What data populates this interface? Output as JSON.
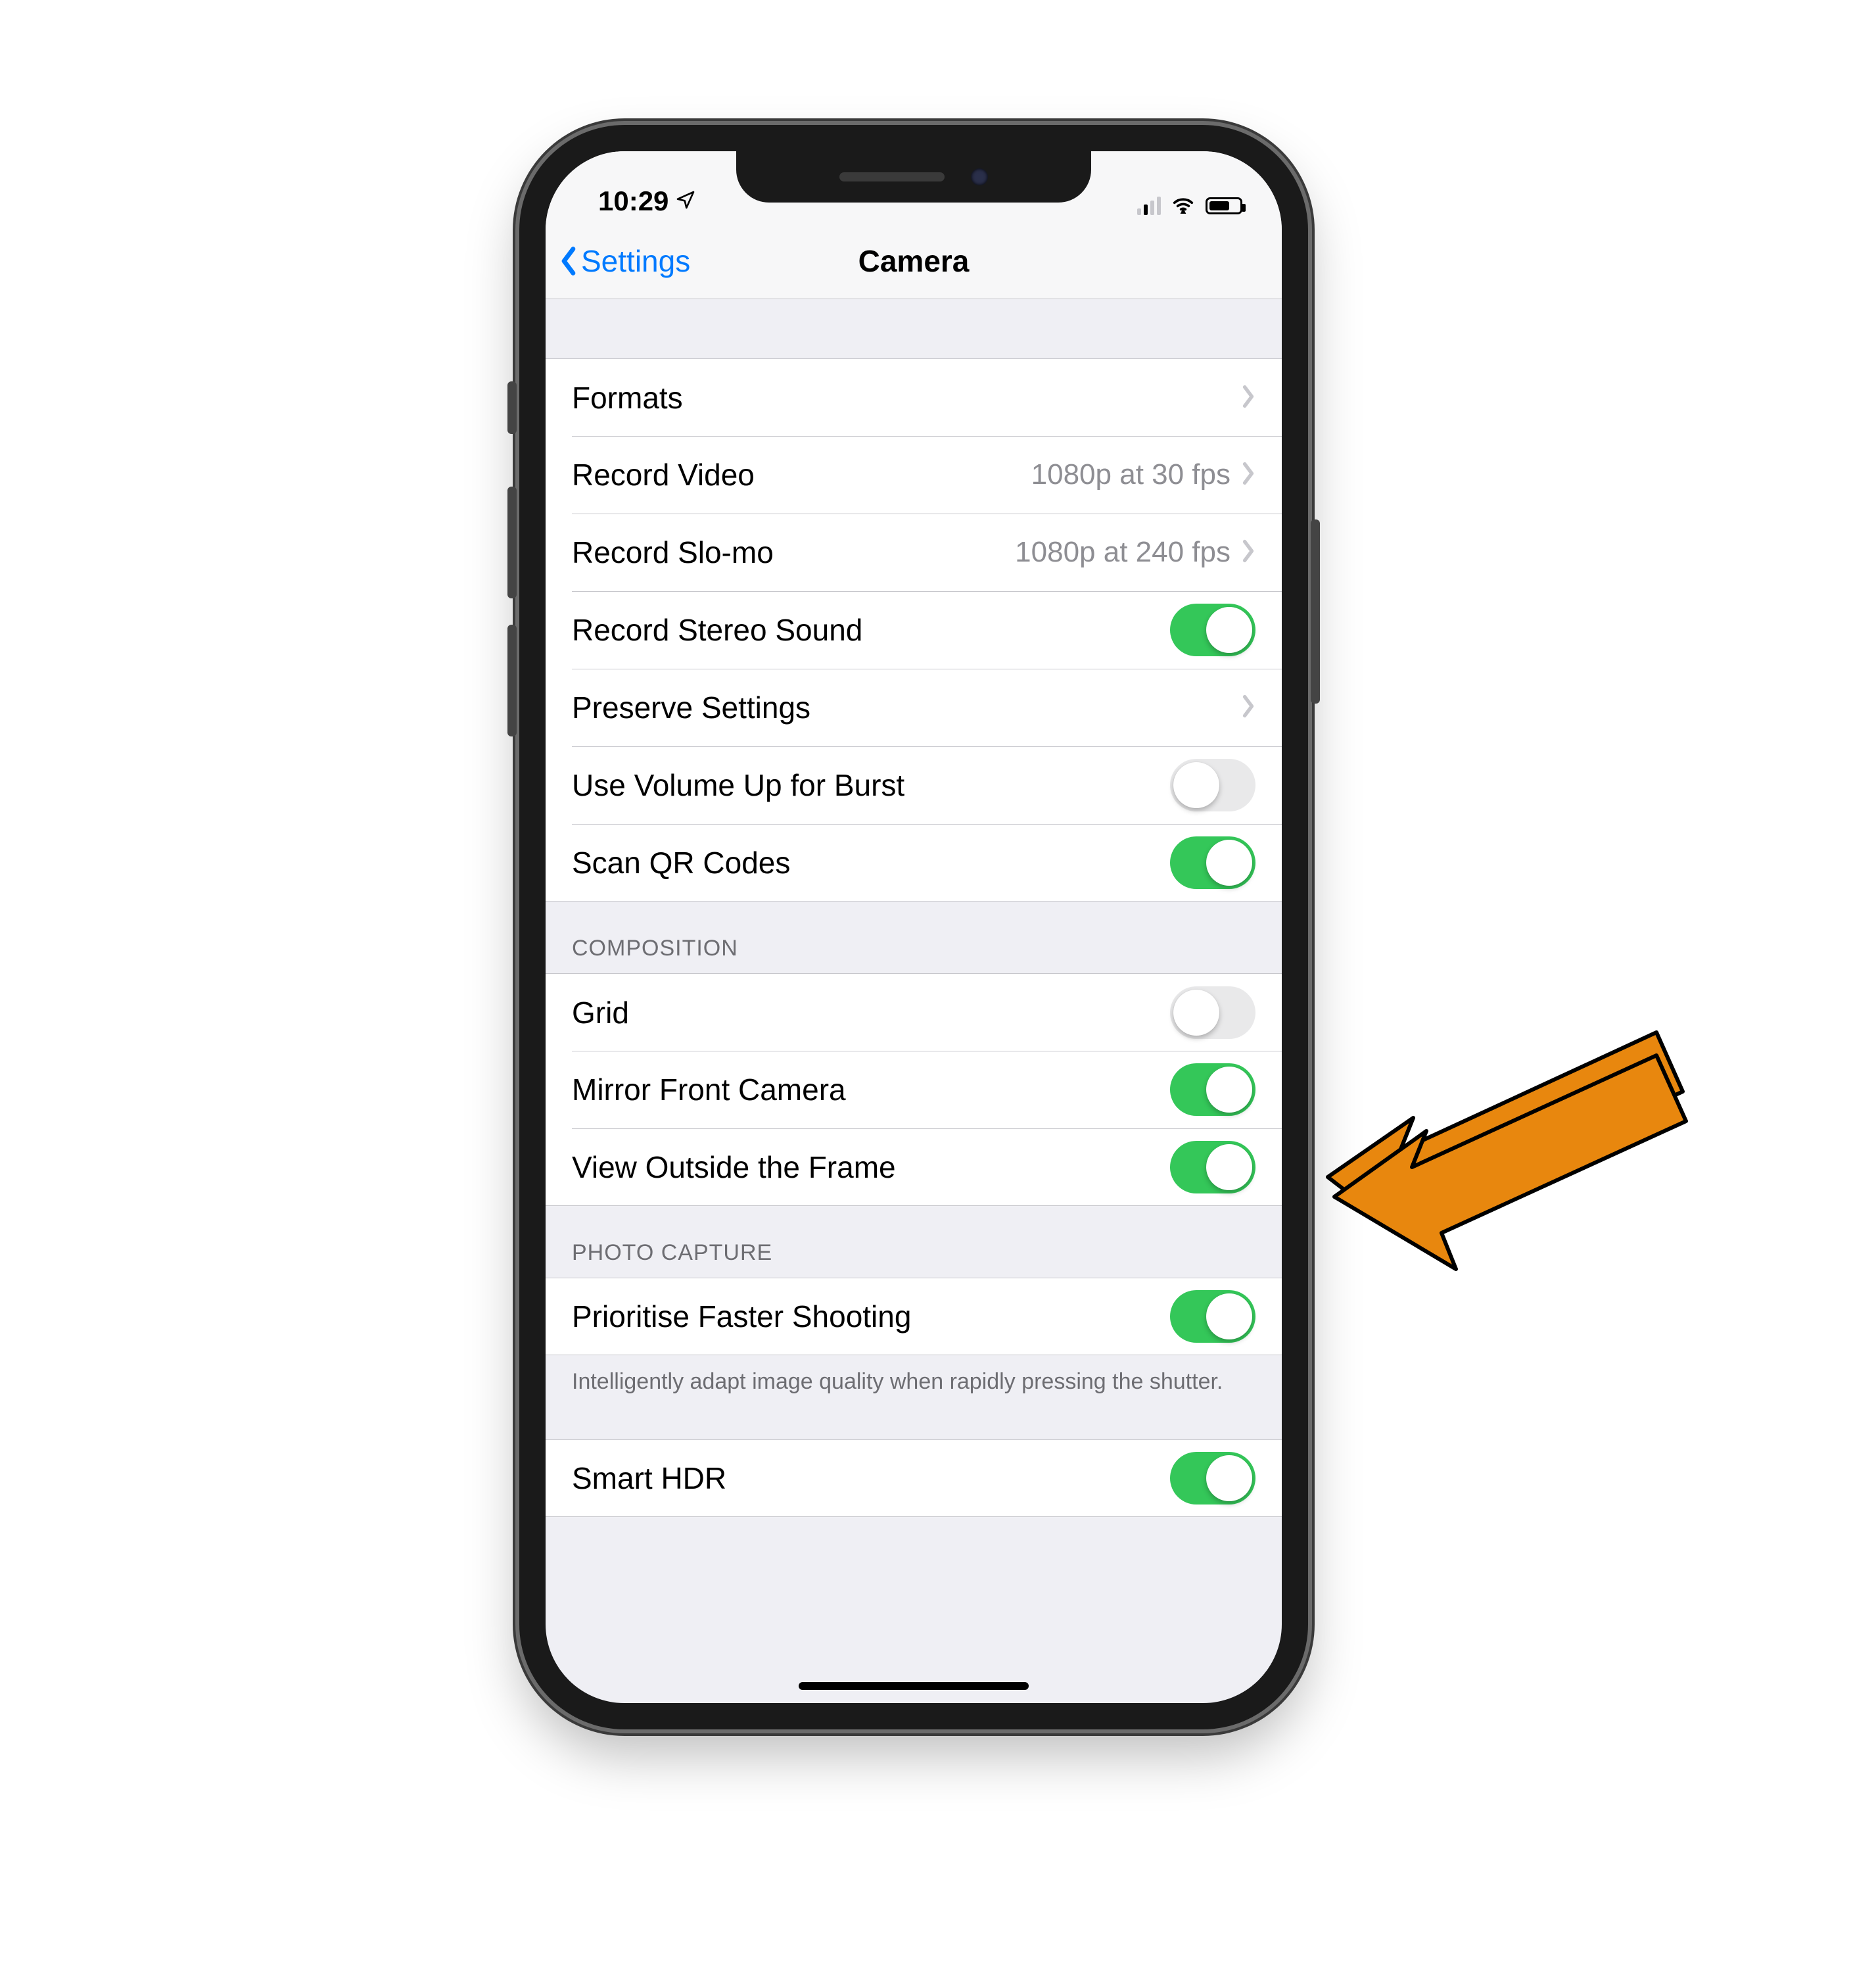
{
  "status": {
    "time": "10:29",
    "location_icon": "location-arrow"
  },
  "nav": {
    "back_label": "Settings",
    "title": "Camera"
  },
  "sections": {
    "main": {
      "formats": {
        "label": "Formats"
      },
      "record_video": {
        "label": "Record Video",
        "value": "1080p at 30 fps"
      },
      "record_slomo": {
        "label": "Record Slo-mo",
        "value": "1080p at 240 fps"
      },
      "stereo": {
        "label": "Record Stereo Sound",
        "on": true
      },
      "preserve": {
        "label": "Preserve Settings"
      },
      "vol_burst": {
        "label": "Use Volume Up for Burst",
        "on": false
      },
      "qr": {
        "label": "Scan QR Codes",
        "on": true
      }
    },
    "composition": {
      "header": "COMPOSITION",
      "grid": {
        "label": "Grid",
        "on": false
      },
      "mirror": {
        "label": "Mirror Front Camera",
        "on": true
      },
      "outside": {
        "label": "View Outside the Frame",
        "on": true
      }
    },
    "photo_capture": {
      "header": "PHOTO CAPTURE",
      "faster": {
        "label": "Prioritise Faster Shooting",
        "on": true
      },
      "faster_footer": "Intelligently adapt image quality when rapidly pressing the shutter.",
      "smart_hdr": {
        "label": "Smart HDR",
        "on": true
      }
    }
  },
  "annotation": {
    "arrow_color": "#e8870e",
    "points_to": "mirror-front-camera-toggle"
  }
}
